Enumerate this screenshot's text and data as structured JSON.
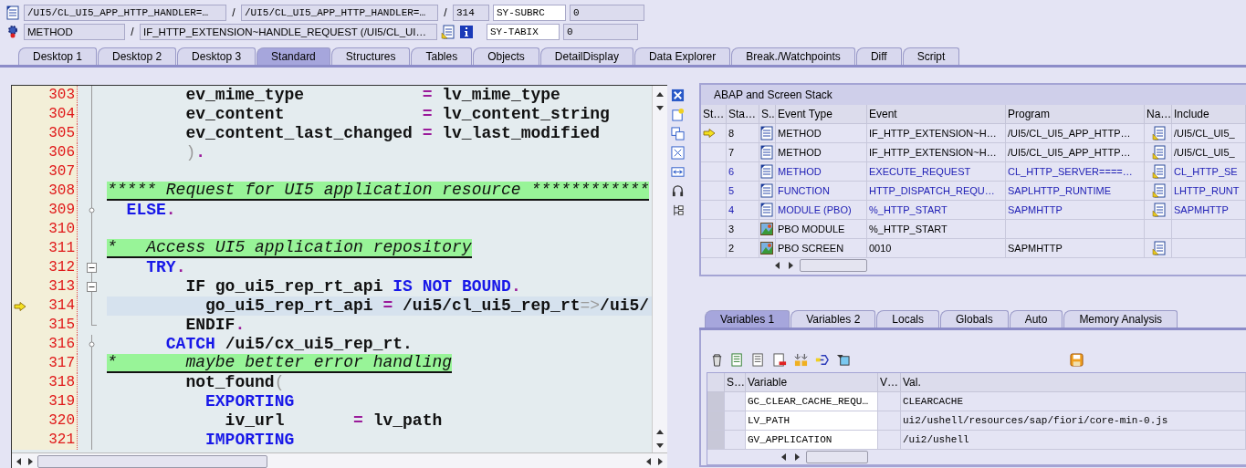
{
  "header": {
    "row_1": {
      "program": "/UI5/CL_UI5_APP_HTTP_HANDLER=…",
      "separator_1": "/",
      "include": "/UI5/CL_UI5_APP_HTTP_HANDLER=…",
      "separator_2": "/",
      "line": "314",
      "field_name": "SY-SUBRC",
      "field_value": "0"
    },
    "row_2": {
      "event_type": "METHOD",
      "separator": "/",
      "event": "IF_HTTP_EXTENSION~HANDLE_REQUEST (/UI5/CL_UI…",
      "field_name": "SY-TABIX",
      "field_value": "0"
    }
  },
  "main_tabs": [
    {
      "label": "Desktop 1",
      "selected": false
    },
    {
      "label": "Desktop 2",
      "selected": false
    },
    {
      "label": "Desktop 3",
      "selected": false
    },
    {
      "label": "Standard",
      "selected": true
    },
    {
      "label": "Structures",
      "selected": false
    },
    {
      "label": "Tables",
      "selected": false
    },
    {
      "label": "Objects",
      "selected": false
    },
    {
      "label": "DetailDisplay",
      "selected": false
    },
    {
      "label": "Data Explorer",
      "selected": false
    },
    {
      "label": "Break./Watchpoints",
      "selected": false
    },
    {
      "label": "Diff",
      "selected": false
    },
    {
      "label": "Script",
      "selected": false
    }
  ],
  "code": [
    {
      "number": "303",
      "current": false,
      "fold_box": false,
      "fold_dot": false,
      "fold_end": false,
      "kind": "code",
      "tokens": [
        {
          "t": "        ev_mime_type            ",
          "kind": "name"
        },
        {
          "t": "=",
          "kind": "operator"
        },
        {
          "t": " lv_mime_type",
          "kind": "name"
        }
      ]
    },
    {
      "number": "304",
      "current": false,
      "fold_box": false,
      "fold_dot": false,
      "fold_end": false,
      "kind": "code",
      "tokens": [
        {
          "t": "        ev_content              ",
          "kind": "name"
        },
        {
          "t": "=",
          "kind": "operator"
        },
        {
          "t": " lv_content_string",
          "kind": "name"
        }
      ]
    },
    {
      "number": "305",
      "current": false,
      "fold_box": false,
      "fold_dot": false,
      "fold_end": false,
      "kind": "code",
      "tokens": [
        {
          "t": "        ev_content_last_changed ",
          "kind": "name"
        },
        {
          "t": "=",
          "kind": "operator"
        },
        {
          "t": " lv_last_modified",
          "kind": "name"
        }
      ]
    },
    {
      "number": "306",
      "current": false,
      "fold_box": false,
      "fold_dot": false,
      "fold_end": false,
      "kind": "code",
      "tokens": [
        {
          "t": "        )",
          "kind": "punct"
        },
        {
          "t": ".",
          "kind": "operator"
        }
      ]
    },
    {
      "number": "307",
      "current": false,
      "fold_box": false,
      "fold_dot": false,
      "fold_end": false,
      "kind": "code"
    },
    {
      "number": "308",
      "current": false,
      "fold_box": false,
      "fold_dot": false,
      "fold_end": false,
      "kind": "comment",
      "text": "***** Request for UI5 application resource ************"
    },
    {
      "number": "309",
      "current": false,
      "fold_box": false,
      "fold_dot": true,
      "fold_end": false,
      "kind": "code",
      "tokens": [
        {
          "t": "  ELSE",
          "kind": "keyword"
        },
        {
          "t": ".",
          "kind": "operator"
        }
      ]
    },
    {
      "number": "310",
      "current": false,
      "fold_box": false,
      "fold_dot": false,
      "fold_end": false,
      "kind": "code"
    },
    {
      "number": "311",
      "current": false,
      "fold_box": false,
      "fold_dot": false,
      "fold_end": false,
      "kind": "comment",
      "text": "*   Access UI5 application repository"
    },
    {
      "number": "312",
      "current": false,
      "fold_box": true,
      "fold_dot": false,
      "fold_end": false,
      "kind": "code",
      "tokens": [
        {
          "t": "    TRY",
          "kind": "keyword"
        },
        {
          "t": ".",
          "kind": "operator"
        }
      ]
    },
    {
      "number": "313",
      "current": false,
      "fold_box": true,
      "fold_dot": false,
      "fold_end": false,
      "kind": "code",
      "tokens": [
        {
          "t": "        IF go_ui5_rep_rt_api ",
          "kind": "name"
        },
        {
          "t": "IS NOT BOUND",
          "kind": "keyword"
        },
        {
          "t": ".",
          "kind": "operator"
        }
      ]
    },
    {
      "number": "314",
      "current": true,
      "fold_box": false,
      "fold_dot": false,
      "fold_end": false,
      "kind": "code",
      "tokens": [
        {
          "t": "          go_ui5_rep_rt_api ",
          "kind": "name"
        },
        {
          "t": "=",
          "kind": "operator"
        },
        {
          "t": " /ui5/cl_ui5_rep_rt",
          "kind": "name"
        },
        {
          "t": "=>",
          "kind": "punct"
        },
        {
          "t": "/ui5/",
          "kind": "name"
        }
      ]
    },
    {
      "number": "315",
      "current": false,
      "fold_box": false,
      "fold_dot": false,
      "fold_end": true,
      "kind": "code",
      "tokens": [
        {
          "t": "        ENDIF",
          "kind": "name"
        },
        {
          "t": ".",
          "kind": "operator"
        }
      ]
    },
    {
      "number": "316",
      "current": false,
      "fold_box": false,
      "fold_dot": true,
      "fold_end": false,
      "kind": "code",
      "tokens": [
        {
          "t": "      CATCH",
          "kind": "keyword"
        },
        {
          "t": " /ui5/cx_ui5_rep_rt.",
          "kind": "name"
        }
      ]
    },
    {
      "number": "317",
      "current": false,
      "fold_box": false,
      "fold_dot": false,
      "fold_end": false,
      "kind": "comment",
      "text": "*       maybe better error handling"
    },
    {
      "number": "318",
      "current": false,
      "fold_box": false,
      "fold_dot": false,
      "fold_end": false,
      "kind": "code",
      "tokens": [
        {
          "t": "        not_found",
          "kind": "name"
        },
        {
          "t": "(",
          "kind": "punct"
        }
      ]
    },
    {
      "number": "319",
      "current": false,
      "fold_box": false,
      "fold_dot": false,
      "fold_end": false,
      "kind": "code",
      "tokens": [
        {
          "t": "          EXPORTING",
          "kind": "keyword"
        }
      ]
    },
    {
      "number": "320",
      "current": false,
      "fold_box": false,
      "fold_dot": false,
      "fold_end": false,
      "kind": "code",
      "tokens": [
        {
          "t": "            iv_url       ",
          "kind": "name"
        },
        {
          "t": "=",
          "kind": "operator"
        },
        {
          "t": " lv_path",
          "kind": "name"
        }
      ]
    },
    {
      "number": "321",
      "current": false,
      "fold_box": false,
      "fold_dot": false,
      "fold_end": false,
      "kind": "code",
      "tokens": [
        {
          "t": "          IMPORTING",
          "kind": "keyword"
        }
      ]
    }
  ],
  "stack": {
    "title": "ABAP and Screen Stack",
    "columns": [
      "St…",
      "Sta…",
      "S..",
      "Event Type",
      "Event",
      "Program",
      "Na…",
      "Include"
    ],
    "rows": [
      {
        "current": true,
        "level": "8",
        "kind": "code",
        "event_type": "METHOD",
        "event": "IF_HTTP_EXTENSION~H…",
        "program": "/UI5/CL_UI5_APP_HTTP…",
        "navigable": true,
        "include": "/UI5/CL_UI5_",
        "linked": false
      },
      {
        "current": false,
        "level": "7",
        "kind": "code",
        "event_type": "METHOD",
        "event": "IF_HTTP_EXTENSION~H…",
        "program": "/UI5/CL_UI5_APP_HTTP…",
        "navigable": true,
        "include": "/UI5/CL_UI5_",
        "linked": false
      },
      {
        "current": false,
        "level": "6",
        "kind": "code",
        "event_type": "METHOD",
        "event": "EXECUTE_REQUEST",
        "program": "CL_HTTP_SERVER====…",
        "navigable": true,
        "include": "CL_HTTP_SE",
        "linked": true
      },
      {
        "current": false,
        "level": "5",
        "kind": "code",
        "event_type": "FUNCTION",
        "event": "HTTP_DISPATCH_REQU…",
        "program": "SAPLHTTP_RUNTIME",
        "navigable": true,
        "include": "LHTTP_RUNT",
        "linked": true
      },
      {
        "current": false,
        "level": "4",
        "kind": "code",
        "event_type": "MODULE (PBO)",
        "event": "%_HTTP_START",
        "program": "SAPMHTTP",
        "navigable": true,
        "include": "SAPMHTTP",
        "linked": true
      },
      {
        "current": false,
        "level": "3",
        "kind": "screen",
        "event_type": "PBO MODULE",
        "event": "%_HTTP_START",
        "navigable": false,
        "linked": false
      },
      {
        "current": false,
        "level": "2",
        "kind": "screen",
        "event_type": "PBO SCREEN",
        "event": "0010",
        "program": "SAPMHTTP",
        "navigable": true,
        "linked": false
      }
    ]
  },
  "variable_tabs": [
    {
      "label": "Variables 1",
      "selected": true
    },
    {
      "label": "Variables 2",
      "selected": false
    },
    {
      "label": "Locals",
      "selected": false
    },
    {
      "label": "Globals",
      "selected": false
    },
    {
      "label": "Auto",
      "selected": false
    },
    {
      "label": "Memory Analysis",
      "selected": false
    }
  ],
  "variables": {
    "columns": [
      "S…",
      "Variable",
      "V…",
      "Val."
    ],
    "rows": [
      {
        "variable": "GC_CLEAR_CACHE_REQU…",
        "value": "CLEARCACHE"
      },
      {
        "variable": "LV_PATH",
        "value": "ui2/ushell/resources/sap/fiori/core-min-0.js"
      },
      {
        "variable": "GV_APPLICATION",
        "value": "/ui2/ushell"
      }
    ]
  }
}
